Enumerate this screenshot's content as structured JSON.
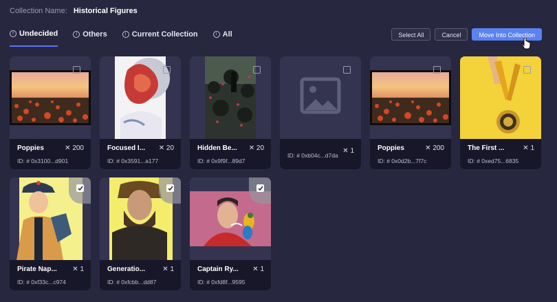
{
  "collection": {
    "label": "Collection Name:",
    "name": "Historical Figures"
  },
  "tabs": [
    {
      "label": "Undecided",
      "active": true
    },
    {
      "label": "Others"
    },
    {
      "label": "Current Collection"
    },
    {
      "label": "All"
    }
  ],
  "actions": {
    "select_all": "Select All",
    "cancel": "Cancel",
    "move": "Move Into Collection"
  },
  "colors": {
    "accent": "#5a82f0",
    "background": "#272740",
    "card": "#353450",
    "card_footer": "#18172a"
  },
  "cards": [
    {
      "title": "Poppies",
      "count": "✕ 200",
      "id": "ID: # 0x3100...d901",
      "image": "poppy-field",
      "checked": false
    },
    {
      "title": "Focused I...",
      "count": "✕ 20",
      "id": "ID: # 0x3591...a177",
      "image": "red-lion-art",
      "checked": false
    },
    {
      "title": "Hidden Be...",
      "count": "✕ 20",
      "id": "ID: # 0x9f9f...89d7",
      "image": "dark-garden-figure",
      "checked": false
    },
    {
      "title": "",
      "count": "✕ 1",
      "id": "ID: # 0xb04c...d7da",
      "image": "image-placeholder-icon",
      "checked": false
    },
    {
      "title": "Poppies",
      "count": "✕ 200",
      "id": "ID: # 0x0d2b...7f7c",
      "image": "poppy-field",
      "checked": false
    },
    {
      "title": "The First ...",
      "count": "✕ 1",
      "id": "ID: # 0xed75...6835",
      "image": "gold-medal-hand",
      "checked": false
    },
    {
      "title": "Pirate Nap...",
      "count": "✕ 1",
      "id": "ID: # 0xf33c...c974",
      "image": "pirate-napoleon-portrait",
      "checked": true
    },
    {
      "title": "Generatio...",
      "count": "✕ 1",
      "id": "ID: # 0xfcbb...dd87",
      "image": "crowned-man-portrait",
      "checked": true
    },
    {
      "title": "Captain Ry...",
      "count": "✕ 1",
      "id": "ID: # 0xfd8f...9595",
      "image": "man-with-parrot",
      "checked": true
    }
  ]
}
